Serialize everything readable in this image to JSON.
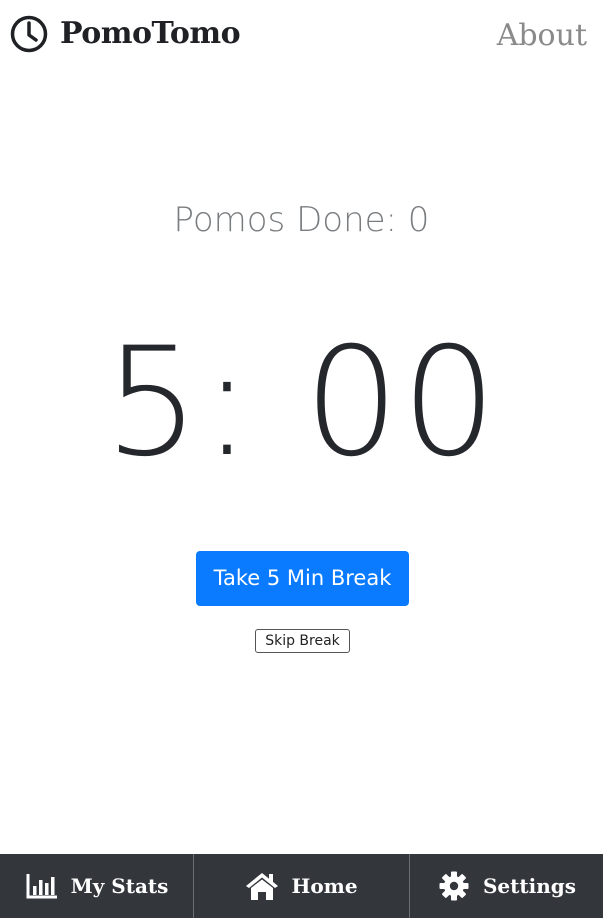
{
  "header": {
    "app_name": "PomoTomo",
    "logo_icon": "clock-icon",
    "about_label": "About"
  },
  "main": {
    "pomos_done_label": "Pomos Done: 0",
    "timer_display": "5: 00",
    "break_button_label": "Take 5 Min Break",
    "skip_button_label": "Skip Break"
  },
  "bottom_nav": {
    "items": [
      {
        "label": "My Stats",
        "icon": "bar-chart-icon"
      },
      {
        "label": "Home",
        "icon": "home-icon"
      },
      {
        "label": "Settings",
        "icon": "gear-icon"
      }
    ]
  },
  "colors": {
    "primary_button": "#0a7bff",
    "nav_background": "#33373c",
    "timer_text": "#24272b",
    "muted_text": "#7a7d80"
  }
}
